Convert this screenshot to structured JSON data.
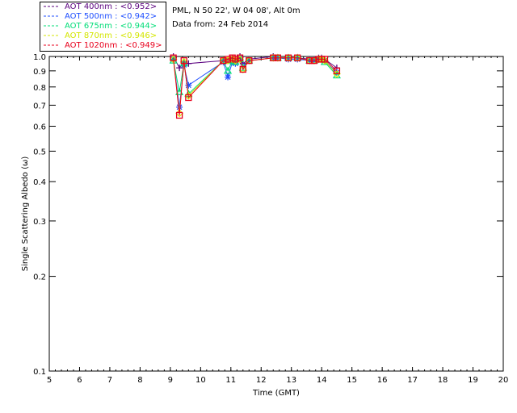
{
  "header": {
    "site": "PML, N 50 22', W 04 08', Alt 0m",
    "date": "Data from: 24 Feb 2014"
  },
  "chart_data": {
    "type": "scatter",
    "xlabel": "Time (GMT)",
    "ylabel": "Single Scattering Albedo (ω)",
    "xlim": [
      5,
      20
    ],
    "ylim": [
      0.1,
      1.0
    ],
    "yscale": "log",
    "x_ticks": [
      5,
      6,
      7,
      8,
      9,
      10,
      11,
      12,
      13,
      14,
      15,
      16,
      17,
      18,
      19,
      20
    ],
    "y_ticks": [
      0.1,
      0.2,
      0.3,
      0.4,
      0.5,
      0.6,
      0.7,
      0.8,
      0.9,
      1.0
    ],
    "legend_position": "top-left",
    "series": [
      {
        "name": "AOT  400nm : <0.952>",
        "color": "#5a007f",
        "marker": "plus",
        "x": [
          9.1,
          9.3,
          9.45,
          9.6,
          10.75,
          10.9,
          11.05,
          11.15,
          11.3,
          11.4,
          11.6,
          12.4,
          12.55,
          12.9,
          13.2,
          13.6,
          13.75,
          13.9,
          14.0,
          14.1,
          14.5
        ],
        "y": [
          1.0,
          0.92,
          0.96,
          0.95,
          0.97,
          0.97,
          0.99,
          0.97,
          1.0,
          0.95,
          0.98,
          1.0,
          0.99,
          0.99,
          0.99,
          0.98,
          0.98,
          0.99,
          0.99,
          0.98,
          0.92
        ]
      },
      {
        "name": "AOT  500nm : <0.942>",
        "color": "#1f4fff",
        "marker": "star",
        "x": [
          9.1,
          9.3,
          9.45,
          9.6,
          10.75,
          10.9,
          11.05,
          11.15,
          11.3,
          11.4,
          11.6,
          12.4,
          12.55,
          12.9,
          13.2,
          13.6,
          13.75,
          13.9,
          14.0,
          14.1,
          14.5
        ],
        "y": [
          0.98,
          0.69,
          0.94,
          0.81,
          0.96,
          0.86,
          0.96,
          0.95,
          0.99,
          0.93,
          0.97,
          0.99,
          0.99,
          0.98,
          0.98,
          0.97,
          0.97,
          0.98,
          0.98,
          0.97,
          0.89
        ]
      },
      {
        "name": "AOT  675nm : <0.944>",
        "color": "#00dd77",
        "marker": "triangle",
        "x": [
          9.1,
          9.3,
          9.45,
          9.6,
          10.75,
          10.9,
          11.05,
          11.15,
          11.3,
          11.4,
          11.6,
          12.4,
          12.55,
          12.9,
          13.2,
          13.6,
          13.75,
          13.9,
          14.0,
          14.1,
          14.5
        ],
        "y": [
          0.97,
          0.77,
          0.95,
          0.76,
          0.97,
          0.9,
          0.97,
          0.96,
          0.98,
          0.92,
          0.97,
          0.99,
          0.99,
          0.99,
          0.99,
          0.97,
          0.97,
          0.98,
          0.98,
          0.96,
          0.87
        ]
      },
      {
        "name": "AOT  870nm : <0.946>",
        "color": "#d4e600",
        "marker": "diamond",
        "x": [
          9.1,
          9.3,
          9.45,
          9.6,
          10.75,
          10.9,
          11.05,
          11.15,
          11.3,
          11.4,
          11.6,
          12.4,
          12.55,
          12.9,
          13.2,
          13.6,
          13.75,
          13.9,
          14.0,
          14.1,
          14.5
        ],
        "y": [
          0.98,
          0.66,
          0.96,
          0.75,
          0.97,
          0.97,
          0.98,
          0.97,
          0.98,
          0.91,
          0.97,
          0.99,
          0.99,
          0.99,
          0.99,
          0.97,
          0.97,
          0.98,
          0.98,
          0.97,
          0.88
        ]
      },
      {
        "name": "AOT 1020nm : <0.949>",
        "color": "#e8001c",
        "marker": "square",
        "x": [
          9.1,
          9.3,
          9.45,
          9.6,
          10.75,
          10.9,
          11.05,
          11.15,
          11.3,
          11.4,
          11.6,
          12.4,
          12.55,
          12.9,
          13.2,
          13.6,
          13.75,
          13.9,
          14.0,
          14.1,
          14.5
        ],
        "y": [
          0.99,
          0.65,
          0.97,
          0.74,
          0.97,
          0.98,
          0.99,
          0.98,
          0.99,
          0.91,
          0.97,
          0.99,
          0.99,
          0.99,
          0.99,
          0.97,
          0.97,
          0.98,
          0.98,
          0.98,
          0.9
        ]
      }
    ]
  }
}
